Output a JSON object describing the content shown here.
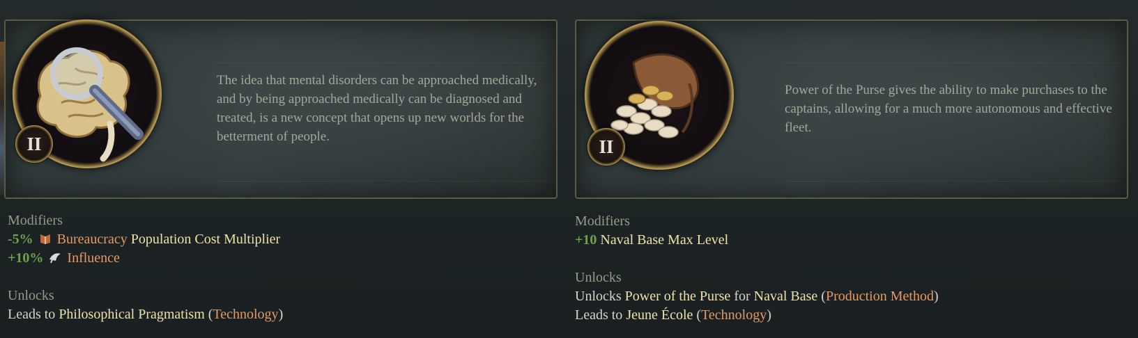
{
  "colors": {
    "accent_green": "#6ea34a",
    "accent_gold": "#efe2a8",
    "accent_orange": "#e59a63",
    "frame_gold": "#c7aa5e"
  },
  "cards": [
    {
      "icon": "brain-magnifying-glass-icon",
      "level": "II",
      "description": "The idea that mental disorders can be approached medically, and by being approached medically can be diagnosed and treated, is a new concept that opens up new worlds for the betterment of people.",
      "modifiers_label": "Modifiers",
      "modifiers": [
        {
          "value": "-5%",
          "icon": "bureaucracy-icon",
          "keyword": "Bureaucracy",
          "text": " Population Cost Multiplier"
        },
        {
          "value": "+10%",
          "icon": "influence-icon",
          "keyword": "Influence",
          "text": ""
        }
      ],
      "unlocks_label": "Unlocks",
      "unlocks": [
        {
          "prefix": "Leads to ",
          "name": "Philosophical Pragmatism",
          "type": "Technology"
        }
      ]
    },
    {
      "icon": "coin-purse-icon",
      "level": "II",
      "description": "Power of the Purse gives the ability to make purchases to the captains, allowing for a much more autonomous and effective fleet.",
      "modifiers_label": "Modifiers",
      "modifiers": [
        {
          "value": "+10",
          "text": "Naval Base Max Level"
        }
      ],
      "unlocks_label": "Unlocks",
      "unlocks": [
        {
          "prefix": "Unlocks ",
          "name": "Power of the Purse",
          "middle": " for ",
          "target": "Naval Base",
          "type": "Production Method"
        },
        {
          "prefix": "Leads to ",
          "name": "Jeune École",
          "type": "Technology"
        }
      ]
    }
  ]
}
